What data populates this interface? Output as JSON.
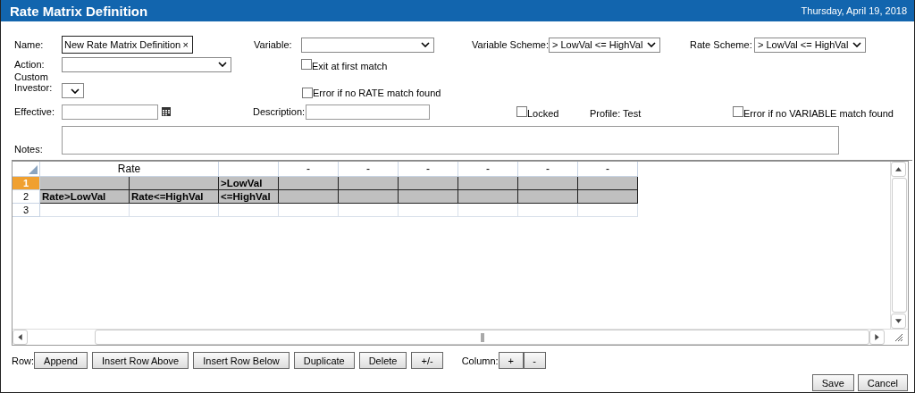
{
  "window": {
    "title": "Rate Matrix Definition",
    "date": "Thursday, April 19, 2018"
  },
  "form": {
    "name": {
      "label": "Name:",
      "value": "New Rate Matrix Definition",
      "clear": "×"
    },
    "variable": {
      "label": "Variable:"
    },
    "variable_scheme": {
      "label": "Variable Scheme:",
      "value": "> LowVal <= HighVal"
    },
    "rate_scheme": {
      "label": "Rate Scheme:",
      "value": "> LowVal <= HighVal"
    },
    "action": {
      "label": "Action:"
    },
    "exit_first": {
      "label": "Exit at first match",
      "checked": false
    },
    "custom_investor": {
      "label": "Custom Investor:"
    },
    "error_rate": {
      "label": "Error if no RATE match found",
      "checked": false
    },
    "effective": {
      "label": "Effective:"
    },
    "description": {
      "label": "Description:"
    },
    "locked": {
      "label": "Locked",
      "checked": false
    },
    "profile": "Profile: Test",
    "error_variable": {
      "label": "Error if no VARIABLE match found",
      "checked": false
    },
    "notes": {
      "label": "Notes:"
    }
  },
  "grid": {
    "columns": [
      {
        "label": "Rate",
        "kind": "merged"
      },
      {
        "kind": "single"
      },
      {
        "label": "-",
        "kind": "single"
      },
      {
        "label": "-",
        "kind": "single"
      },
      {
        "label": "-",
        "kind": "single"
      },
      {
        "label": "-",
        "kind": "single"
      },
      {
        "label": "-",
        "kind": "single"
      },
      {
        "label": "-",
        "kind": "single"
      }
    ],
    "rows": [
      {
        "number": "1",
        "selected": true,
        "shaded": true,
        "cells": [
          {},
          {},
          {
            "text": ">LowVal"
          },
          {},
          {},
          {},
          {},
          {},
          {}
        ]
      },
      {
        "number": "2",
        "selected": false,
        "shaded": true,
        "cells": [
          {
            "text": "Rate>LowVal"
          },
          {
            "text": "Rate<=HighVal"
          },
          {
            "text": "<=HighVal"
          },
          {},
          {},
          {},
          {},
          {},
          {}
        ]
      },
      {
        "number": "3",
        "selected": false,
        "shaded": false,
        "cells": [
          {},
          {},
          {},
          {},
          {},
          {},
          {},
          {},
          {}
        ]
      }
    ]
  },
  "row_toolbar": {
    "label": "Row:",
    "buttons": [
      "Append",
      "Insert Row Above",
      "Insert Row Below",
      "Duplicate",
      "Delete",
      "+/-"
    ]
  },
  "column_toolbar": {
    "label": "Column:",
    "buttons": [
      "+",
      "-"
    ]
  },
  "actions": [
    "Save",
    "Cancel"
  ]
}
